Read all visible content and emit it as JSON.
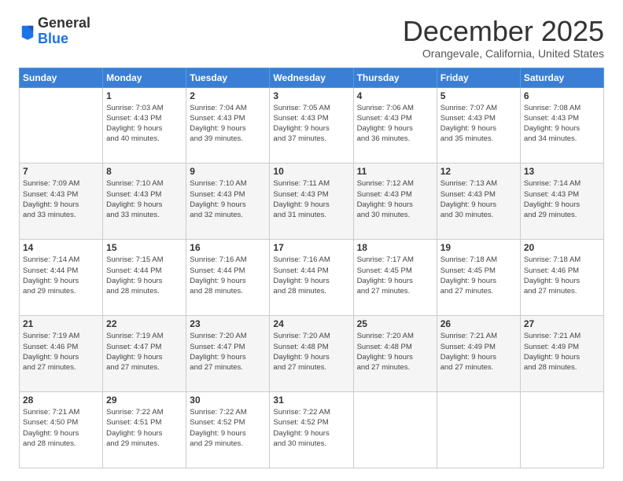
{
  "logo": {
    "general": "General",
    "blue": "Blue"
  },
  "header": {
    "month": "December 2025",
    "location": "Orangevale, California, United States"
  },
  "days_header": [
    "Sunday",
    "Monday",
    "Tuesday",
    "Wednesday",
    "Thursday",
    "Friday",
    "Saturday"
  ],
  "weeks": [
    [
      {
        "day": "",
        "info": ""
      },
      {
        "day": "1",
        "info": "Sunrise: 7:03 AM\nSunset: 4:43 PM\nDaylight: 9 hours\nand 40 minutes."
      },
      {
        "day": "2",
        "info": "Sunrise: 7:04 AM\nSunset: 4:43 PM\nDaylight: 9 hours\nand 39 minutes."
      },
      {
        "day": "3",
        "info": "Sunrise: 7:05 AM\nSunset: 4:43 PM\nDaylight: 9 hours\nand 37 minutes."
      },
      {
        "day": "4",
        "info": "Sunrise: 7:06 AM\nSunset: 4:43 PM\nDaylight: 9 hours\nand 36 minutes."
      },
      {
        "day": "5",
        "info": "Sunrise: 7:07 AM\nSunset: 4:43 PM\nDaylight: 9 hours\nand 35 minutes."
      },
      {
        "day": "6",
        "info": "Sunrise: 7:08 AM\nSunset: 4:43 PM\nDaylight: 9 hours\nand 34 minutes."
      }
    ],
    [
      {
        "day": "7",
        "info": "Sunrise: 7:09 AM\nSunset: 4:43 PM\nDaylight: 9 hours\nand 33 minutes."
      },
      {
        "day": "8",
        "info": "Sunrise: 7:10 AM\nSunset: 4:43 PM\nDaylight: 9 hours\nand 33 minutes."
      },
      {
        "day": "9",
        "info": "Sunrise: 7:10 AM\nSunset: 4:43 PM\nDaylight: 9 hours\nand 32 minutes."
      },
      {
        "day": "10",
        "info": "Sunrise: 7:11 AM\nSunset: 4:43 PM\nDaylight: 9 hours\nand 31 minutes."
      },
      {
        "day": "11",
        "info": "Sunrise: 7:12 AM\nSunset: 4:43 PM\nDaylight: 9 hours\nand 30 minutes."
      },
      {
        "day": "12",
        "info": "Sunrise: 7:13 AM\nSunset: 4:43 PM\nDaylight: 9 hours\nand 30 minutes."
      },
      {
        "day": "13",
        "info": "Sunrise: 7:14 AM\nSunset: 4:43 PM\nDaylight: 9 hours\nand 29 minutes."
      }
    ],
    [
      {
        "day": "14",
        "info": "Sunrise: 7:14 AM\nSunset: 4:44 PM\nDaylight: 9 hours\nand 29 minutes."
      },
      {
        "day": "15",
        "info": "Sunrise: 7:15 AM\nSunset: 4:44 PM\nDaylight: 9 hours\nand 28 minutes."
      },
      {
        "day": "16",
        "info": "Sunrise: 7:16 AM\nSunset: 4:44 PM\nDaylight: 9 hours\nand 28 minutes."
      },
      {
        "day": "17",
        "info": "Sunrise: 7:16 AM\nSunset: 4:44 PM\nDaylight: 9 hours\nand 28 minutes."
      },
      {
        "day": "18",
        "info": "Sunrise: 7:17 AM\nSunset: 4:45 PM\nDaylight: 9 hours\nand 27 minutes."
      },
      {
        "day": "19",
        "info": "Sunrise: 7:18 AM\nSunset: 4:45 PM\nDaylight: 9 hours\nand 27 minutes."
      },
      {
        "day": "20",
        "info": "Sunrise: 7:18 AM\nSunset: 4:46 PM\nDaylight: 9 hours\nand 27 minutes."
      }
    ],
    [
      {
        "day": "21",
        "info": "Sunrise: 7:19 AM\nSunset: 4:46 PM\nDaylight: 9 hours\nand 27 minutes."
      },
      {
        "day": "22",
        "info": "Sunrise: 7:19 AM\nSunset: 4:47 PM\nDaylight: 9 hours\nand 27 minutes."
      },
      {
        "day": "23",
        "info": "Sunrise: 7:20 AM\nSunset: 4:47 PM\nDaylight: 9 hours\nand 27 minutes."
      },
      {
        "day": "24",
        "info": "Sunrise: 7:20 AM\nSunset: 4:48 PM\nDaylight: 9 hours\nand 27 minutes."
      },
      {
        "day": "25",
        "info": "Sunrise: 7:20 AM\nSunset: 4:48 PM\nDaylight: 9 hours\nand 27 minutes."
      },
      {
        "day": "26",
        "info": "Sunrise: 7:21 AM\nSunset: 4:49 PM\nDaylight: 9 hours\nand 27 minutes."
      },
      {
        "day": "27",
        "info": "Sunrise: 7:21 AM\nSunset: 4:49 PM\nDaylight: 9 hours\nand 28 minutes."
      }
    ],
    [
      {
        "day": "28",
        "info": "Sunrise: 7:21 AM\nSunset: 4:50 PM\nDaylight: 9 hours\nand 28 minutes."
      },
      {
        "day": "29",
        "info": "Sunrise: 7:22 AM\nSunset: 4:51 PM\nDaylight: 9 hours\nand 29 minutes."
      },
      {
        "day": "30",
        "info": "Sunrise: 7:22 AM\nSunset: 4:52 PM\nDaylight: 9 hours\nand 29 minutes."
      },
      {
        "day": "31",
        "info": "Sunrise: 7:22 AM\nSunset: 4:52 PM\nDaylight: 9 hours\nand 30 minutes."
      },
      {
        "day": "",
        "info": ""
      },
      {
        "day": "",
        "info": ""
      },
      {
        "day": "",
        "info": ""
      }
    ]
  ]
}
